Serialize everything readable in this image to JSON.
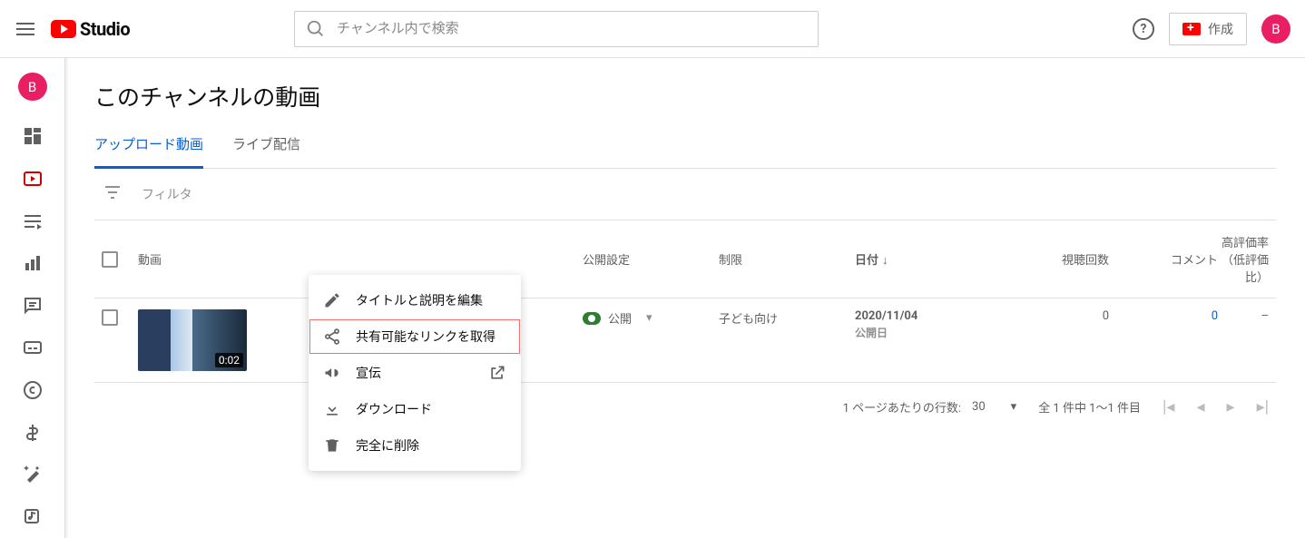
{
  "header": {
    "logo_text": "Studio",
    "search_placeholder": "チャンネル内で検索",
    "create_label": "作成",
    "avatar_initial": "B"
  },
  "sidebar": {
    "avatar_initial": "B"
  },
  "page": {
    "title": "このチャンネルの動画"
  },
  "tabs": [
    {
      "label": "アップロード動画",
      "active": true
    },
    {
      "label": "ライブ配信",
      "active": false
    }
  ],
  "filter": {
    "label": "フィルタ"
  },
  "columns": {
    "video": "動画",
    "visibility": "公開設定",
    "restrictions": "制限",
    "date": "日付",
    "views": "視聴回数",
    "comments": "コメント",
    "likes": "高評価率（低評価比）"
  },
  "rows": [
    {
      "duration": "0:02",
      "visibility": "公開",
      "restrictions": "子ども向け",
      "date": "2020/11/04",
      "date_sub": "公開日",
      "views": "0",
      "comments": "0",
      "likes": "–"
    }
  ],
  "pagination": {
    "per_page_label": "1 ページあたりの行数:",
    "per_page_value": "30",
    "range": "全 1 件中 1～1 件目"
  },
  "context_menu": [
    {
      "label": "タイトルと説明を編集",
      "icon": "edit"
    },
    {
      "label": "共有可能なリンクを取得",
      "icon": "share",
      "highlighted": true
    },
    {
      "label": "宣伝",
      "icon": "promote",
      "external": true
    },
    {
      "label": "ダウンロード",
      "icon": "download"
    },
    {
      "label": "完全に削除",
      "icon": "delete"
    }
  ]
}
